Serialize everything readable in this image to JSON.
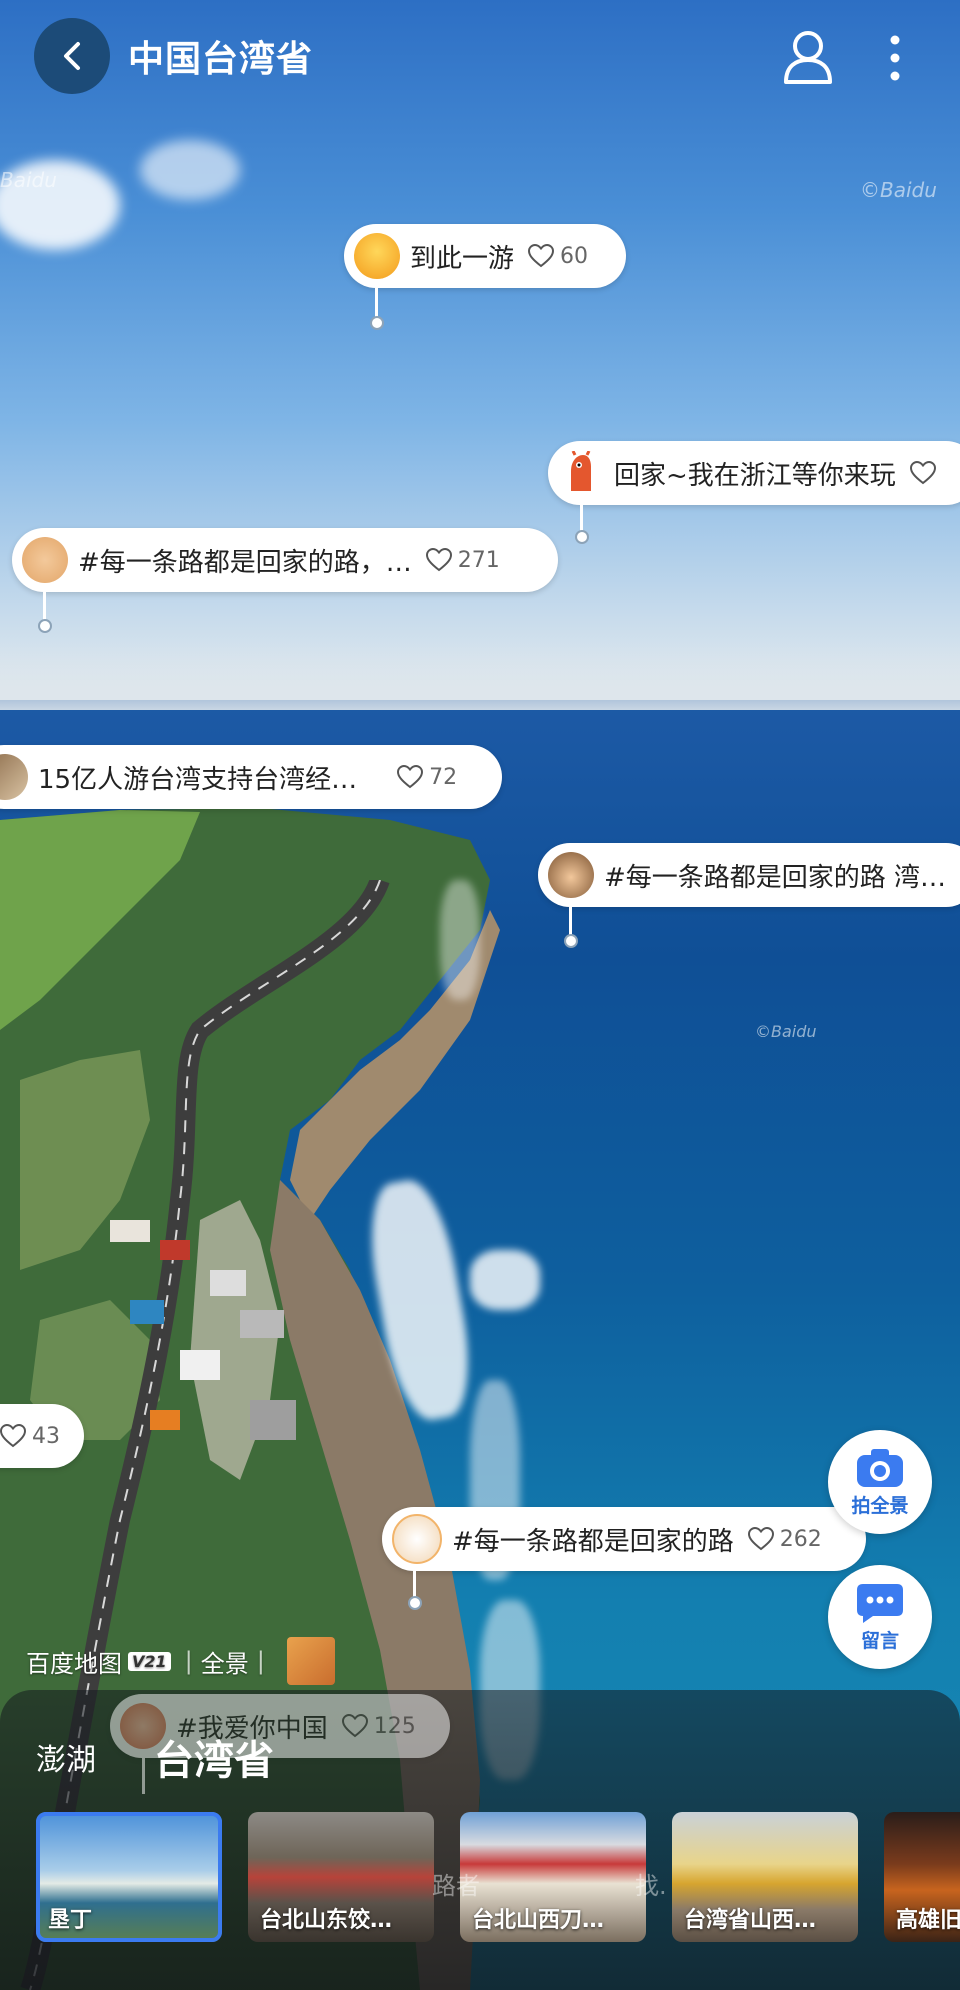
{
  "header": {
    "title": "中国台湾省"
  },
  "watermarks": [
    "Baidu",
    "©Baidu",
    "©Baidu"
  ],
  "comments": [
    {
      "text": "到此一游",
      "likes": "60",
      "avatar": "sun-avatar"
    },
    {
      "text": "回家~我在浙江等你来玩",
      "likes": "",
      "avatar": "alpaca-avatar"
    },
    {
      "text": "#每一条路都是回家的路，…",
      "likes": "271",
      "avatar": "bear-avatar"
    },
    {
      "text": "15亿人游台湾支持台湾经…",
      "likes": "72",
      "avatar": "person-avatar"
    },
    {
      "text": "#每一条路都是回家的路 湾…",
      "likes": "",
      "avatar": "boy-avatar"
    },
    {
      "text": "",
      "likes": "43",
      "avatar": ""
    },
    {
      "text": "#每一条路都是回家的路",
      "likes": "262",
      "avatar": "cat-avatar"
    },
    {
      "text": "#我爱你中国",
      "likes": "125",
      "avatar": "face-avatar"
    }
  ],
  "side_buttons": {
    "panorama_label": "拍全景",
    "message_label": "留言"
  },
  "credit": {
    "brand": "百度地图",
    "version": "V21",
    "mode": "全景"
  },
  "panel": {
    "tab_secondary": "澎湖",
    "tab_primary": "台湾省",
    "overlay_text_1": "路者",
    "overlay_text_2": "找."
  },
  "thumbnails": [
    {
      "caption": "垦丁",
      "selected": true
    },
    {
      "caption": "台北山东饺…",
      "selected": false
    },
    {
      "caption": "台北山西刀…",
      "selected": false
    },
    {
      "caption": "台湾省山西…",
      "selected": false
    },
    {
      "caption": "高雄旧",
      "selected": false
    }
  ],
  "colors": {
    "accent": "#3b7bf0",
    "back_button_bg": "#1c4b78"
  }
}
